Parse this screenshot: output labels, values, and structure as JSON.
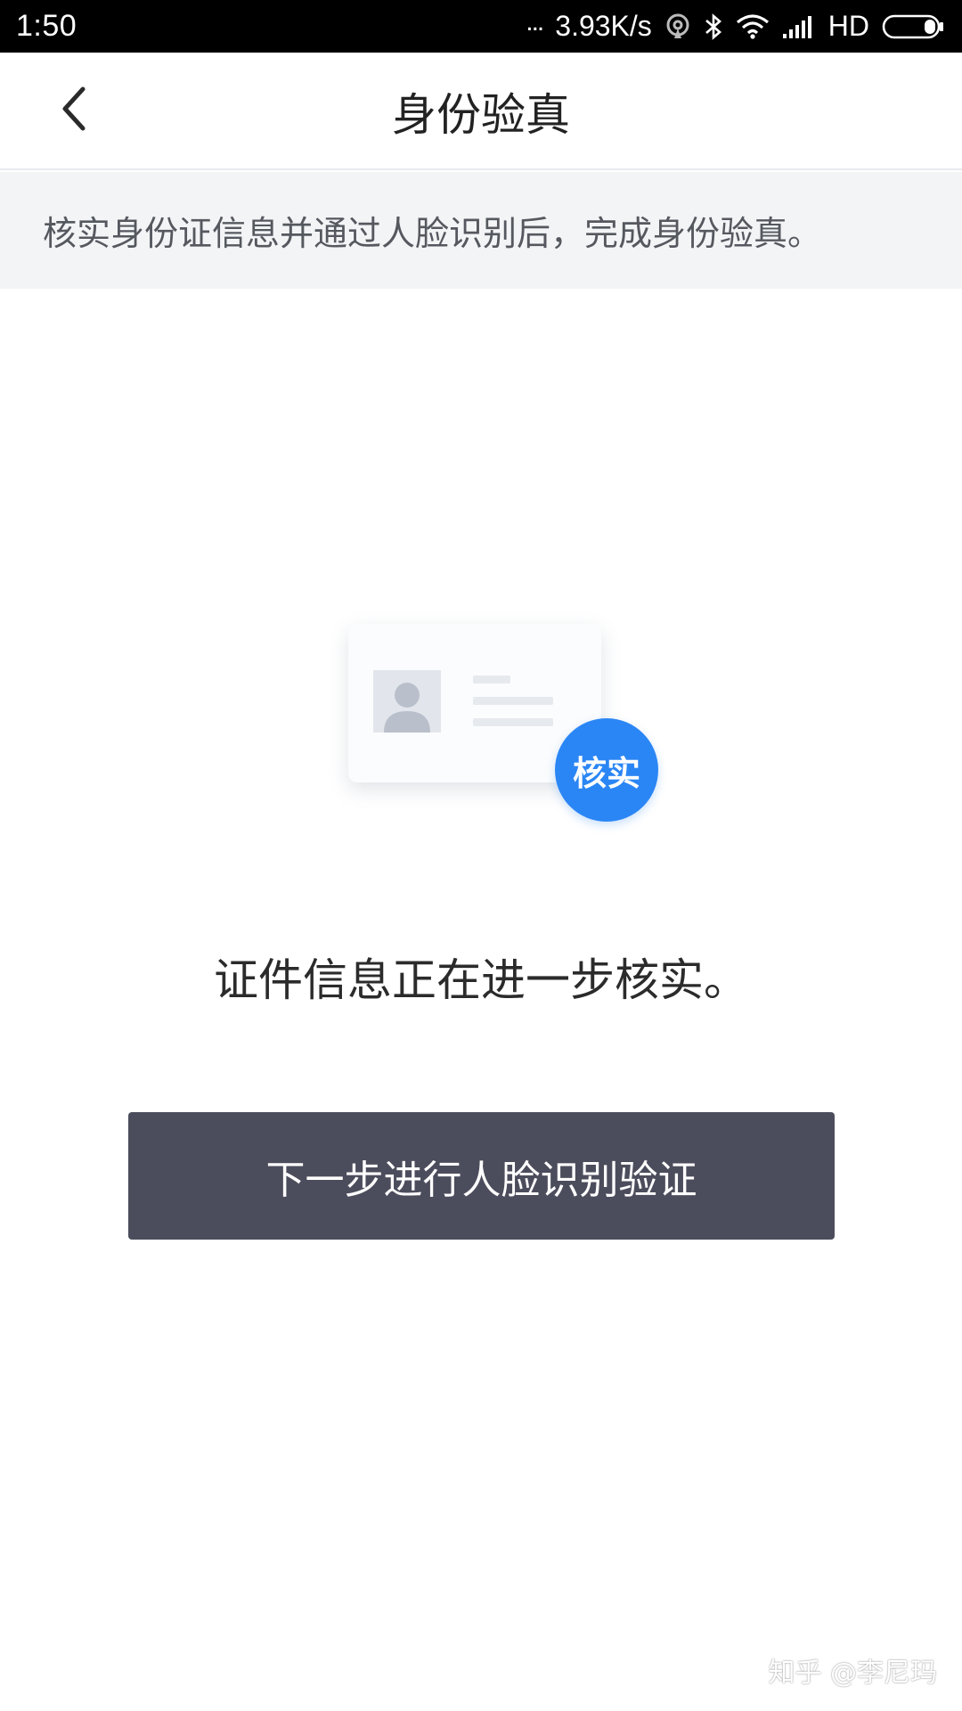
{
  "status_bar": {
    "time": "1:50",
    "dots": "...",
    "network_speed": "3.93K/s",
    "network_type": "HD",
    "icons": [
      "hotspot-icon",
      "bluetooth-icon",
      "wifi-icon",
      "signal-icon",
      "battery-icon"
    ]
  },
  "header": {
    "back_icon": "chevron-left-icon",
    "title": "身份验真"
  },
  "banner": {
    "text": "核实身份证信息并通过人脸识别后，完成身份验真。"
  },
  "illustration": {
    "badge_label": "核实",
    "badge_color": "#2b86f5"
  },
  "main": {
    "status_text": "证件信息正在进一步核实。",
    "next_button_label": "下一步进行人脸识别验证"
  },
  "watermark": {
    "text": "知乎 @李尼玛"
  },
  "colors": {
    "button_bg": "#4c4d5c",
    "banner_bg": "#f3f4f6",
    "accent": "#2b86f5"
  }
}
